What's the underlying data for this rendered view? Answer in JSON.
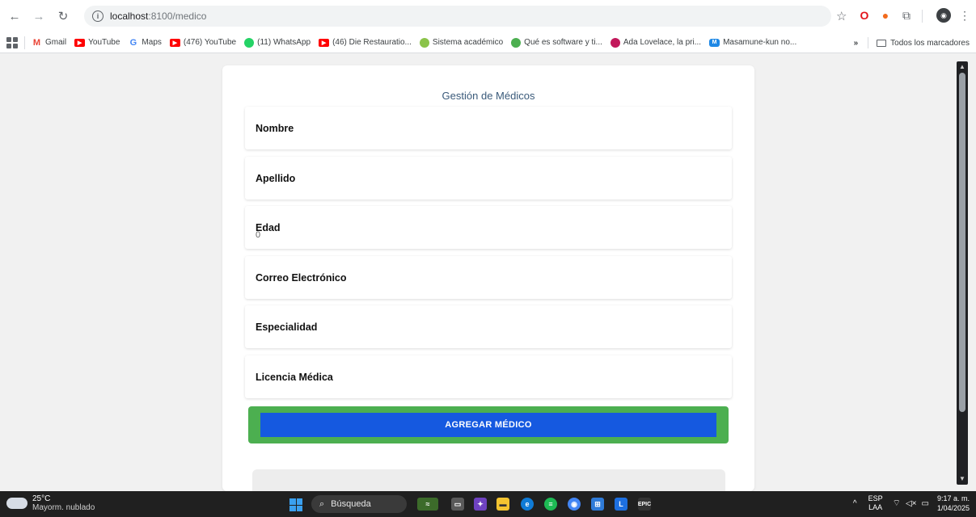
{
  "browser": {
    "url_host": "localhost",
    "url_path": ":8100/medico",
    "back_icon": "arrow-left-icon",
    "forward_icon": "arrow-right-icon",
    "reload_icon": "reload-icon"
  },
  "bookmarks": {
    "items": [
      {
        "label": "Gmail",
        "color": "#ea4335",
        "icon": "M"
      },
      {
        "label": "YouTube",
        "color": "#ff0000",
        "icon": "▶"
      },
      {
        "label": "Maps",
        "color": "#4285f4",
        "icon": "G"
      },
      {
        "label": "(476) YouTube",
        "color": "#ff0000",
        "icon": "▶"
      },
      {
        "label": "(11) WhatsApp",
        "color": "#25d366",
        "icon": "●"
      },
      {
        "label": "(46) Die Restauratio...",
        "color": "#ff0000",
        "icon": "▶"
      },
      {
        "label": "Sistema académico",
        "color": "#8bc34a",
        "icon": "●"
      },
      {
        "label": "Qué es software y ti...",
        "color": "#4caf50",
        "icon": "●"
      },
      {
        "label": "Ada Lovelace, la pri...",
        "color": "#c2185b",
        "icon": "●"
      },
      {
        "label": "Masamune-kun no...",
        "color": "#1e88e5",
        "icon": "M"
      }
    ],
    "overflow": "»",
    "all_bookmarks": "Todos los marcadores"
  },
  "page": {
    "title": "Gestión de Médicos",
    "fields": [
      {
        "label": "Nombre",
        "value": ""
      },
      {
        "label": "Apellido",
        "value": ""
      },
      {
        "label": "Edad",
        "value": "0"
      },
      {
        "label": "Correo Electrónico",
        "value": ""
      },
      {
        "label": "Especialidad",
        "value": ""
      },
      {
        "label": "Licencia Médica",
        "value": ""
      }
    ],
    "add_button": "AGREGAR MÉDICO",
    "colors": {
      "button_bg": "#1559e0",
      "button_border": "#4caf50",
      "title": "#3a5a7a"
    }
  },
  "taskbar": {
    "temperature": "25°C",
    "weather": "Mayorm. nublado",
    "search": "Búsqueda",
    "lang_top": "ESP",
    "lang_bottom": "LAA",
    "time": "9:17 a. m.",
    "date": "1/04/2025"
  }
}
